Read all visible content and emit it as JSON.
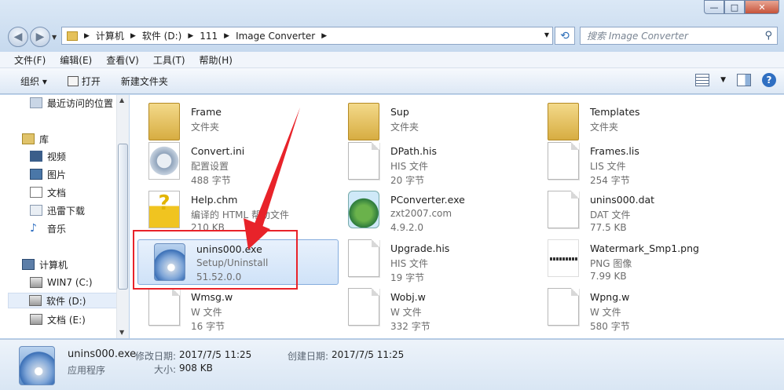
{
  "window": {
    "minimize": "—",
    "maximize": "□",
    "close": "✕"
  },
  "address": {
    "segments": [
      "计算机",
      "软件 (D:)",
      "111",
      "Image Converter"
    ]
  },
  "search": {
    "placeholder": "搜索 Image Converter"
  },
  "menu": [
    "文件(F)",
    "编辑(E)",
    "查看(V)",
    "工具(T)",
    "帮助(H)"
  ],
  "toolbar": {
    "organize": "组织 ▾",
    "open": "打开",
    "new_folder": "新建文件夹"
  },
  "nav": {
    "items": [
      {
        "label": "最近访问的位置",
        "icon": "recent-places-icon"
      },
      {
        "label": "库",
        "icon": "library-icon"
      },
      {
        "label": "视频",
        "icon": "video-icon"
      },
      {
        "label": "图片",
        "icon": "pictures-icon"
      },
      {
        "label": "文档",
        "icon": "documents-icon"
      },
      {
        "label": "迅雷下载",
        "icon": "download-icon"
      },
      {
        "label": "音乐",
        "icon": "music-icon"
      },
      {
        "label": "计算机",
        "icon": "computer-icon"
      },
      {
        "label": "WIN7 (C:)",
        "icon": "drive-icon"
      },
      {
        "label": "软件 (D:)",
        "icon": "drive-icon"
      },
      {
        "label": "文档 (E:)",
        "icon": "drive-icon"
      }
    ]
  },
  "files": [
    {
      "name": "Frame",
      "l2": "文件夹",
      "l3": "",
      "icon": "folder-icon"
    },
    {
      "name": "Sup",
      "l2": "文件夹",
      "l3": "",
      "icon": "folder-icon"
    },
    {
      "name": "Templates",
      "l2": "文件夹",
      "l3": "",
      "icon": "folder-icon"
    },
    {
      "name": "Convert.ini",
      "l2": "配置设置",
      "l3": "488 字节",
      "icon": "config-file-icon"
    },
    {
      "name": "DPath.his",
      "l2": "HIS 文件",
      "l3": "20 字节",
      "icon": "document-icon"
    },
    {
      "name": "Frames.lis",
      "l2": "LIS 文件",
      "l3": "254 字节",
      "icon": "document-icon"
    },
    {
      "name": "Help.chm",
      "l2": "编译的 HTML 帮助文件",
      "l3": "210 KB",
      "icon": "help-file-icon"
    },
    {
      "name": "PConverter.exe",
      "l2": "zxt2007.com",
      "l3": "4.9.2.0",
      "icon": "application-icon"
    },
    {
      "name": "unins000.dat",
      "l2": "DAT 文件",
      "l3": "77.5 KB",
      "icon": "document-icon"
    },
    {
      "name": "unins000.exe",
      "l2": "Setup/Uninstall",
      "l3": "51.52.0.0",
      "icon": "setup-icon"
    },
    {
      "name": "Upgrade.his",
      "l2": "HIS 文件",
      "l3": "19 字节",
      "icon": "document-icon"
    },
    {
      "name": "Watermark_Smp1.png",
      "l2": "PNG 图像",
      "l3": "7.99 KB",
      "icon": "image-file-icon"
    },
    {
      "name": "Wmsg.w",
      "l2": "W 文件",
      "l3": "16 字节",
      "icon": "document-icon"
    },
    {
      "name": "Wobj.w",
      "l2": "W 文件",
      "l3": "332 字节",
      "icon": "document-icon"
    },
    {
      "name": "Wpng.w",
      "l2": "W 文件",
      "l3": "580 字节",
      "icon": "document-icon"
    }
  ],
  "status": {
    "filename": "unins000.exe",
    "type": "应用程序",
    "modified_label": "修改日期:",
    "modified_value": "2017/7/5 11:25",
    "created_label": "创建日期:",
    "created_value": "2017/7/5 11:25",
    "size_label": "大小:",
    "size_value": "908 KB"
  },
  "colors": {
    "annotation": "#e8232a",
    "selection": "#cfe2f8"
  }
}
